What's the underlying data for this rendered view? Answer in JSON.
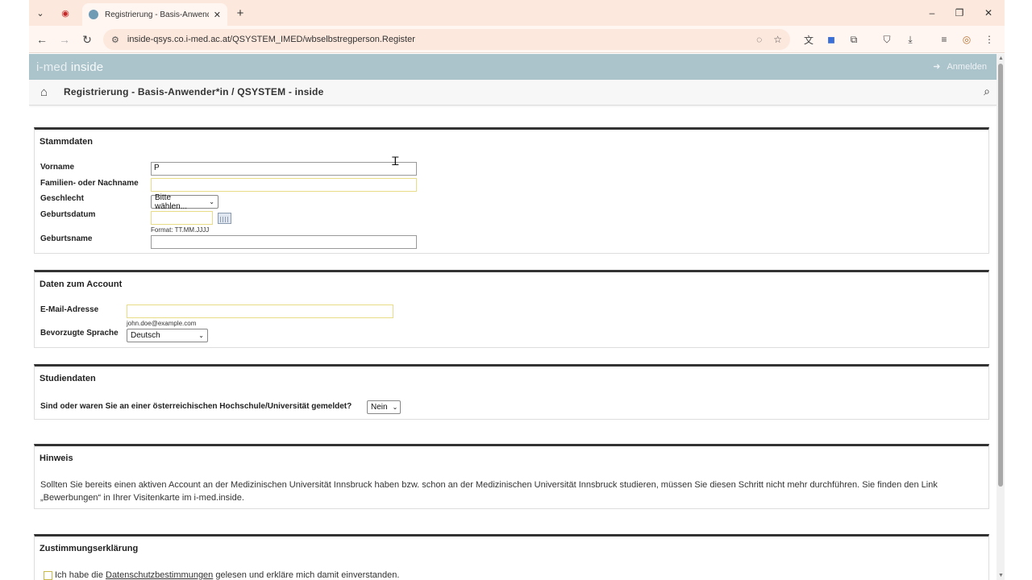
{
  "browser": {
    "tab_title": "Registrierung - Basis-Anwender*in",
    "url": "inside-qsys.co.i-med.ac.at/QSYSTEM_IMED/wbselbstregperson.Register"
  },
  "site": {
    "brand_part1": "i-med",
    "brand_part2": "inside",
    "login_label": "Anmelden",
    "breadcrumb": "Registrierung - Basis-Anwender*in / QSYSTEM - inside"
  },
  "stammdaten": {
    "title": "Stammdaten",
    "vorname_label": "Vorname",
    "vorname_value": "P",
    "nachname_label": "Familien- oder Nachname",
    "nachname_value": "",
    "geschlecht_label": "Geschlecht",
    "geschlecht_value": "Bitte wählen...",
    "geburtsdatum_label": "Geburtsdatum",
    "geburtsdatum_value": "",
    "geburtsdatum_hint": "Format: TT.MM.JJJJ",
    "geburtsname_label": "Geburtsname",
    "geburtsname_value": ""
  },
  "account": {
    "title": "Daten zum Account",
    "email_label": "E-Mail-Adresse",
    "email_value": "",
    "email_hint": "john.doe@example.com",
    "sprache_label": "Bevorzugte Sprache",
    "sprache_value": "Deutsch"
  },
  "studien": {
    "title": "Studiendaten",
    "frage": "Sind oder waren Sie an einer österreichischen Hochschule/Universität gemeldet?",
    "antwort": "Nein"
  },
  "hinweis": {
    "title": "Hinweis",
    "text": "Sollten Sie bereits einen aktiven Account an der Medizinischen Universität Innsbruck haben bzw. schon an der Medizinischen Universität Innsbruck studieren, müssen Sie diesen Schritt nicht mehr durchführen. Sie finden den Link „Bewerbungen“ in Ihrer Visitenkarte im i-med.inside."
  },
  "zustimmung": {
    "title": "Zustimmungserklärung",
    "text_before": "Ich habe die",
    "link": "Datenschutzbestimmungen",
    "text_after": "gelesen und erkläre mich damit einverstanden."
  },
  "colors": {
    "banner": "#abc3cb",
    "tabstrip": "#fde8dd",
    "required_border": "#e8dc86"
  },
  "icons": [
    "chevron-down-icon",
    "record-icon",
    "globe-favicon",
    "close-icon",
    "plus-icon",
    "back-icon",
    "forward-icon",
    "reload-icon",
    "site-info-icon",
    "eye-off-icon",
    "star-icon",
    "home-icon",
    "search-icon",
    "calendar-icon",
    "login-icon"
  ]
}
